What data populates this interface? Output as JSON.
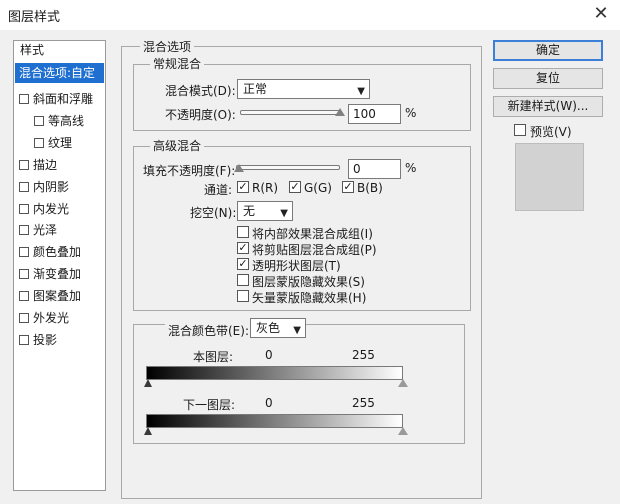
{
  "window": {
    "title": "图层样式",
    "close_glyph": "✕"
  },
  "styles_panel": {
    "title": "样式",
    "items": [
      {
        "label": "混合选项:自定",
        "selected": true,
        "checkbox": false
      },
      {
        "label": "斜面和浮雕",
        "checkbox": true
      },
      {
        "label": "等高线",
        "checkbox": true,
        "sub": true
      },
      {
        "label": "纹理",
        "checkbox": true,
        "sub": true
      },
      {
        "label": "描边",
        "checkbox": true
      },
      {
        "label": "内阴影",
        "checkbox": true
      },
      {
        "label": "内发光",
        "checkbox": true
      },
      {
        "label": "光泽",
        "checkbox": true
      },
      {
        "label": "颜色叠加",
        "checkbox": true
      },
      {
        "label": "渐变叠加",
        "checkbox": true
      },
      {
        "label": "图案叠加",
        "checkbox": true
      },
      {
        "label": "外发光",
        "checkbox": true
      },
      {
        "label": "投影",
        "checkbox": true
      }
    ]
  },
  "blend_options": {
    "title": "混合选项",
    "general": {
      "title": "常规混合",
      "mode_label": "混合模式(D):",
      "mode_value": "正常",
      "opacity_label": "不透明度(O):",
      "opacity_value": "100",
      "opacity_unit": "%",
      "opacity_level": 1.0
    },
    "advanced": {
      "title": "高级混合",
      "fill_label": "填充不透明度(F):",
      "fill_value": "0",
      "fill_unit": "%",
      "fill_level": 0.0,
      "channels_label": "通道:",
      "channel_r": "R(R)",
      "channel_g": "G(G)",
      "channel_b": "B(B)",
      "knockout_label": "挖空(N):",
      "knockout_value": "无",
      "options": [
        {
          "label": "将内部效果混合成组(I)",
          "checked": false
        },
        {
          "label": "将剪贴图层混合成组(P)",
          "checked": true
        },
        {
          "label": "透明形状图层(T)",
          "checked": true
        },
        {
          "label": "图层蒙版隐藏效果(S)",
          "checked": false
        },
        {
          "label": "矢量蒙版隐藏效果(H)",
          "checked": false
        }
      ]
    },
    "blend_if": {
      "label": "混合颜色带(E):",
      "value": "灰色",
      "this_layer_label": "本图层:",
      "this_low": "0",
      "this_high": "255",
      "under_layer_label": "下一图层:",
      "under_low": "0",
      "under_high": "255"
    }
  },
  "buttons": {
    "ok": "确定",
    "reset": "复位",
    "new_style": "新建样式(W)...",
    "preview": "预览(V)"
  }
}
